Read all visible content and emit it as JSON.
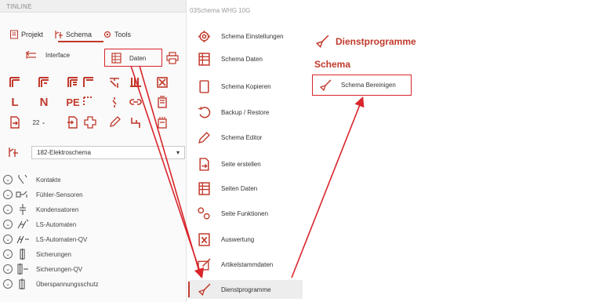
{
  "app_title": "TINLINE",
  "document_title": "03Schema WHG 10G",
  "tabs": [
    {
      "label": "Projekt"
    },
    {
      "label": "Schema"
    },
    {
      "label": "Tools"
    }
  ],
  "toolbar": {
    "interface_label": "Interface",
    "daten_label": "Daten",
    "font_size_value": "22"
  },
  "schema_select": {
    "value": "182-Elektroschema"
  },
  "symbol_list": [
    {
      "label": "Kontakte"
    },
    {
      "label": "Fühler-Sensoren"
    },
    {
      "label": "Kondensatoren"
    },
    {
      "label": "LS-Automaten"
    },
    {
      "label": "LS-Automaten-QV"
    },
    {
      "label": "Sicherungen"
    },
    {
      "label": "Sicherungen-QV"
    },
    {
      "label": "Überspannungsschutz"
    }
  ],
  "nav_items": [
    {
      "label": "Schema Einstellungen",
      "icon": "gear-icon"
    },
    {
      "label": "Schema Daten",
      "icon": "data-sheet-icon"
    },
    {
      "label": "Schema Kopieren",
      "icon": "copy-icon"
    },
    {
      "label": "Backup / Restore",
      "icon": "restore-icon"
    },
    {
      "label": "Schema Editor",
      "icon": "pencil-icon"
    },
    {
      "label": "Seite erstellen",
      "icon": "new-page-icon"
    },
    {
      "label": "Seiten Daten",
      "icon": "data-sheet-icon"
    },
    {
      "label": "Seite Funktionen",
      "icon": "functions-icon"
    },
    {
      "label": "Auswertung",
      "icon": "excel-icon"
    },
    {
      "label": "Artikelstammdaten",
      "icon": "article-icon"
    },
    {
      "label": "Dienstprogramme",
      "icon": "broom-icon"
    }
  ],
  "right_panel": {
    "header": "Dienstprogramme",
    "section": "Schema",
    "action_label": "Schema Bereinigen"
  },
  "colors": {
    "accent": "#c0392b",
    "highlight": "#d9252b"
  }
}
